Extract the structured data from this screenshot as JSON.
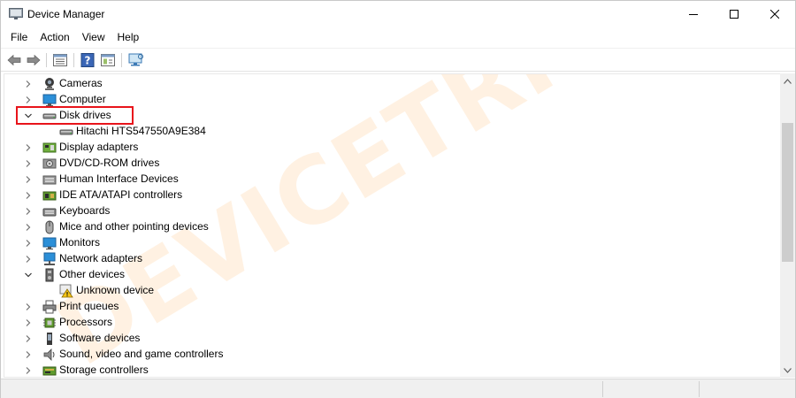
{
  "window": {
    "title": "Device Manager",
    "controls": {
      "minimize": "minimize",
      "maximize": "maximize",
      "close": "close"
    }
  },
  "menu": [
    "File",
    "Action",
    "View",
    "Help"
  ],
  "toolbar": {
    "buttons": [
      "back-arrow-icon",
      "forward-arrow-icon",
      "properties-list-icon",
      "help-icon",
      "details-view-icon",
      "scan-hardware-icon"
    ]
  },
  "tree": {
    "rows": [
      {
        "label": "Cameras",
        "expanded": false,
        "indent": 0,
        "icon": "camera-icon"
      },
      {
        "label": "Computer",
        "expanded": false,
        "indent": 0,
        "icon": "computer-icon"
      },
      {
        "label": "Disk drives",
        "expanded": true,
        "indent": 0,
        "icon": "disk-drive-icon",
        "highlighted": true
      },
      {
        "label": "Hitachi HTS547550A9E384",
        "indent": 1,
        "icon": "disk-drive-icon"
      },
      {
        "label": "Display adapters",
        "expanded": false,
        "indent": 0,
        "icon": "display-adapter-icon"
      },
      {
        "label": "DVD/CD-ROM drives",
        "expanded": false,
        "indent": 0,
        "icon": "dvd-drive-icon"
      },
      {
        "label": "Human Interface Devices",
        "expanded": false,
        "indent": 0,
        "icon": "hid-icon"
      },
      {
        "label": "IDE ATA/ATAPI controllers",
        "expanded": false,
        "indent": 0,
        "icon": "ide-controller-icon"
      },
      {
        "label": "Keyboards",
        "expanded": false,
        "indent": 0,
        "icon": "keyboard-icon"
      },
      {
        "label": "Mice and other pointing devices",
        "expanded": false,
        "indent": 0,
        "icon": "mouse-icon"
      },
      {
        "label": "Monitors",
        "expanded": false,
        "indent": 0,
        "icon": "monitor-icon"
      },
      {
        "label": "Network adapters",
        "expanded": false,
        "indent": 0,
        "icon": "network-adapter-icon"
      },
      {
        "label": "Other devices",
        "expanded": true,
        "indent": 0,
        "icon": "other-devices-icon"
      },
      {
        "label": "Unknown device",
        "indent": 1,
        "icon": "unknown-device-warning-icon"
      },
      {
        "label": "Print queues",
        "expanded": false,
        "indent": 0,
        "icon": "printer-icon"
      },
      {
        "label": "Processors",
        "expanded": false,
        "indent": 0,
        "icon": "processor-icon"
      },
      {
        "label": "Software devices",
        "expanded": false,
        "indent": 0,
        "icon": "software-device-icon"
      },
      {
        "label": "Sound, video and game controllers",
        "expanded": false,
        "indent": 0,
        "icon": "speaker-icon"
      },
      {
        "label": "Storage controllers",
        "expanded": false,
        "indent": 0,
        "icon": "storage-controller-icon"
      }
    ]
  },
  "watermark": "DEVICETRICKS",
  "colors": {
    "highlight_box": "#e8141b",
    "watermark": "#ffa64d",
    "scroll_thumb": "#cdcdcd"
  }
}
